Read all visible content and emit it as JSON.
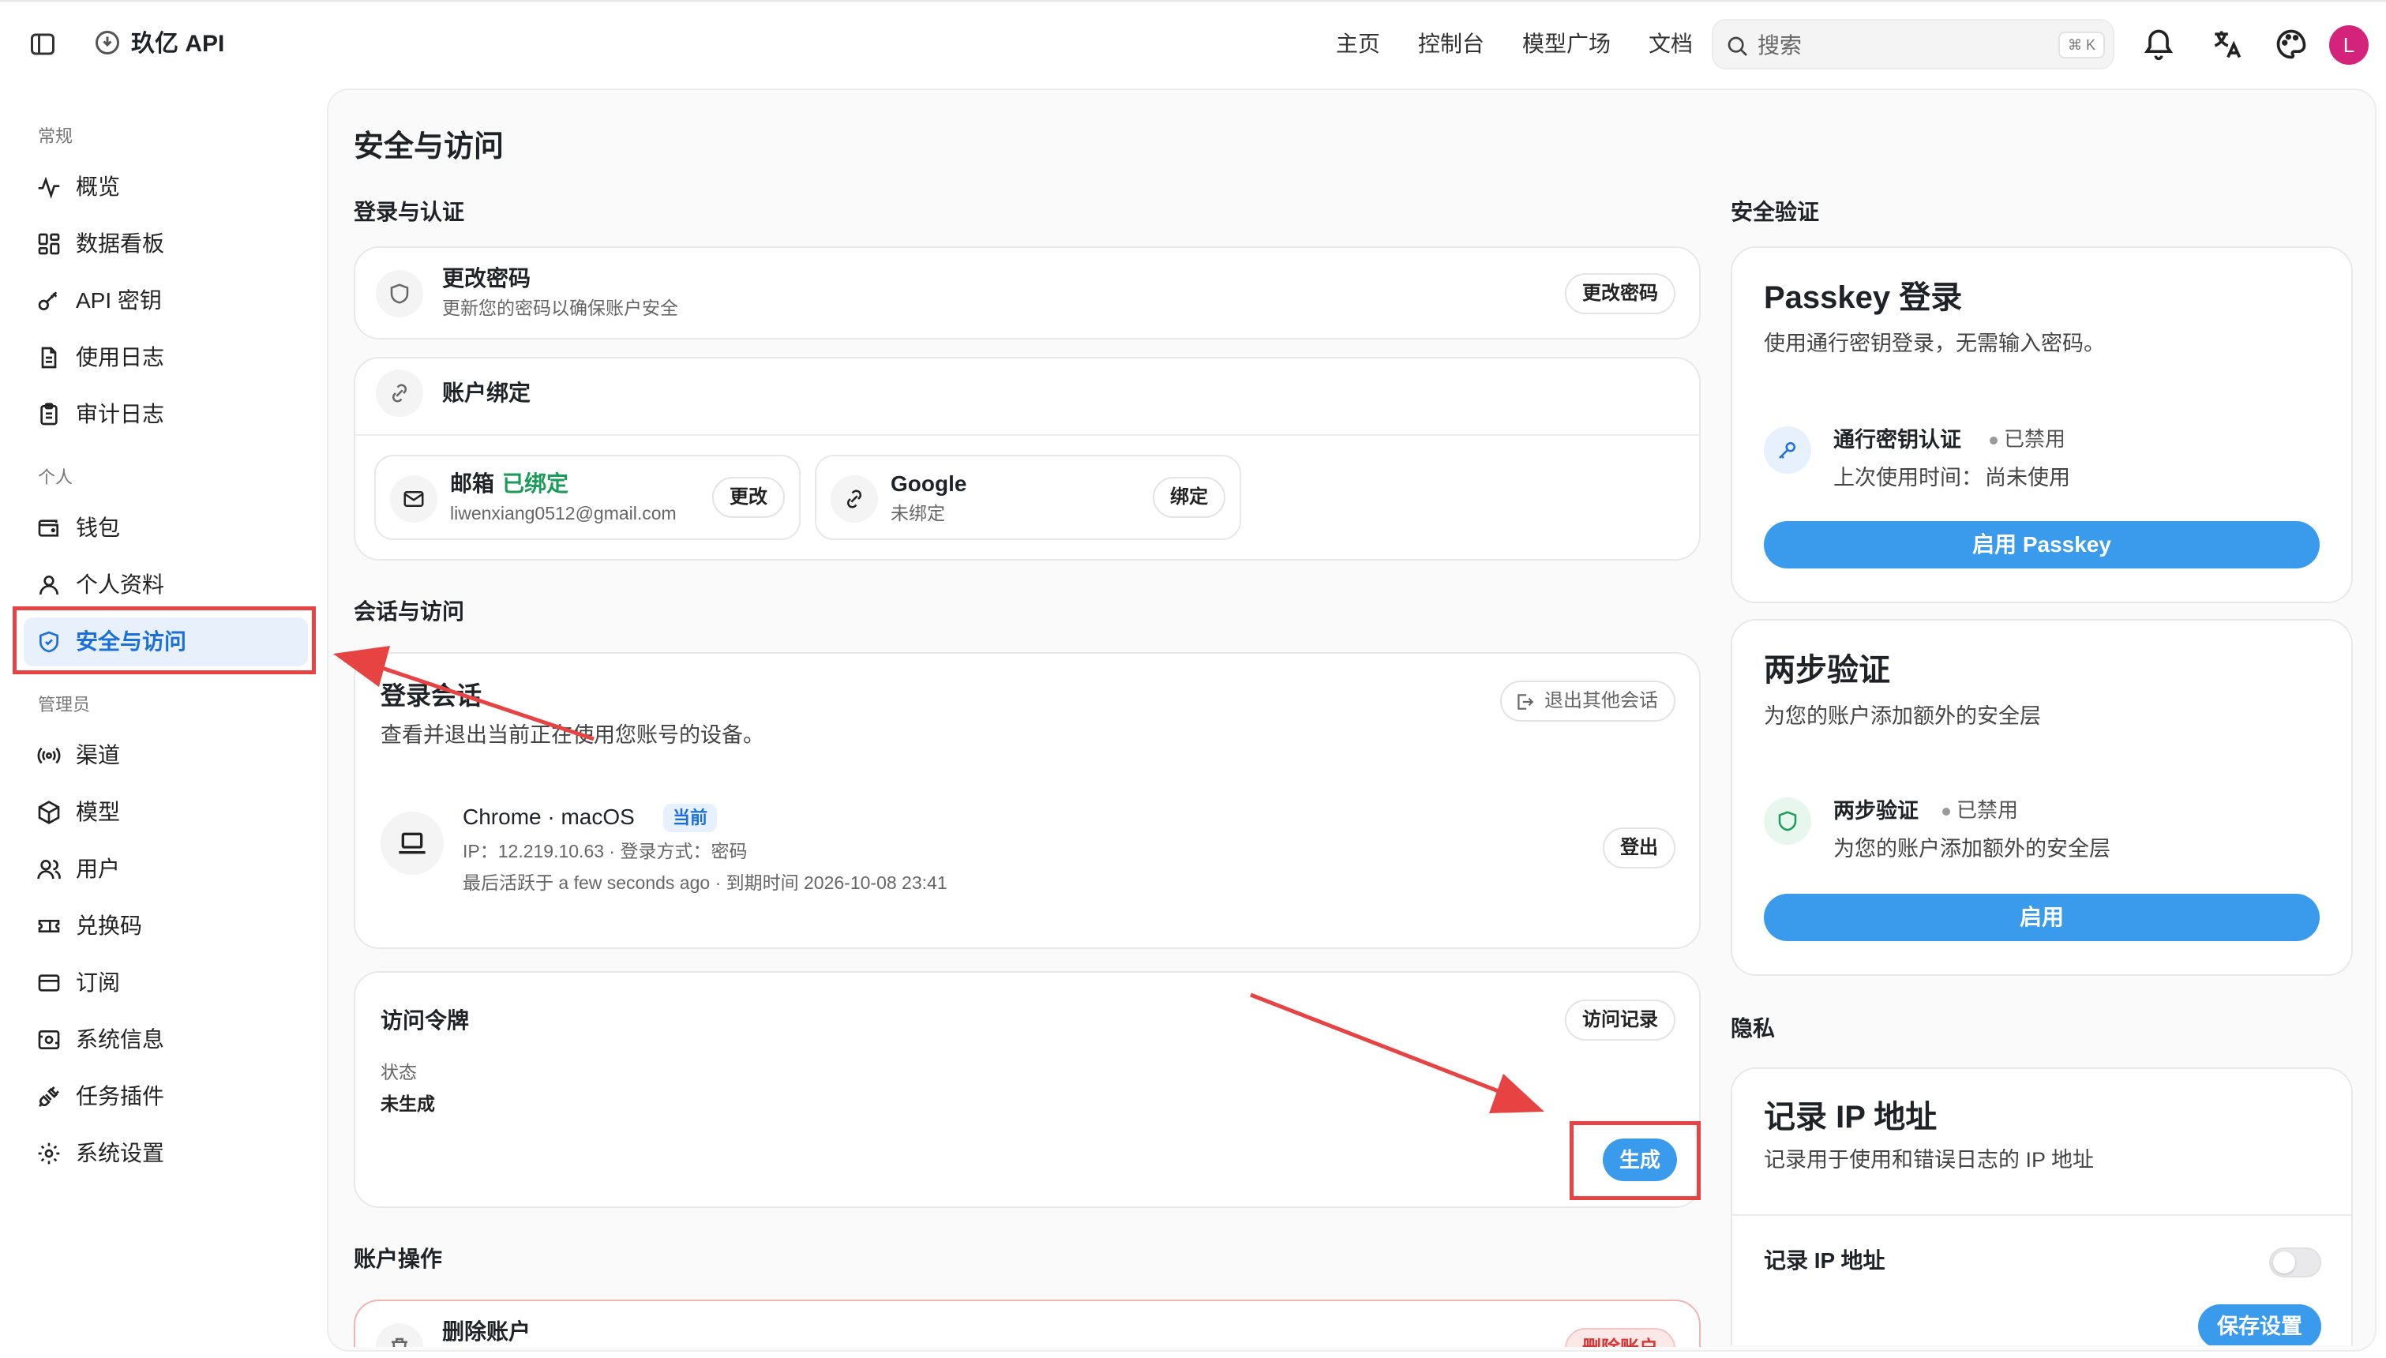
{
  "header": {
    "app_title": "玖亿 API",
    "nav": [
      "主页",
      "控制台",
      "模型广场",
      "文档"
    ],
    "search_placeholder": "搜索",
    "search_shortcut": "⌘ K",
    "avatar_letter": "L"
  },
  "sidebar": {
    "sections": [
      {
        "title": "常规",
        "items": [
          {
            "label": "概览",
            "icon": "activity-icon"
          },
          {
            "label": "数据看板",
            "icon": "dashboard-icon"
          },
          {
            "label": "API 密钥",
            "icon": "key-icon"
          },
          {
            "label": "使用日志",
            "icon": "file-text-icon"
          },
          {
            "label": "审计日志",
            "icon": "clipboard-icon"
          }
        ]
      },
      {
        "title": "个人",
        "items": [
          {
            "label": "钱包",
            "icon": "wallet-icon"
          },
          {
            "label": "个人资料",
            "icon": "user-icon"
          },
          {
            "label": "安全与访问",
            "icon": "shield-icon",
            "active": true
          }
        ]
      },
      {
        "title": "管理员",
        "items": [
          {
            "label": "渠道",
            "icon": "radio-icon"
          },
          {
            "label": "模型",
            "icon": "box-icon"
          },
          {
            "label": "用户",
            "icon": "users-icon"
          },
          {
            "label": "兑换码",
            "icon": "ticket-icon"
          },
          {
            "label": "订阅",
            "icon": "credit-card-icon"
          },
          {
            "label": "系统信息",
            "icon": "server-icon"
          },
          {
            "label": "任务插件",
            "icon": "plug-icon"
          },
          {
            "label": "系统设置",
            "icon": "settings-icon"
          }
        ]
      }
    ]
  },
  "page": {
    "title": "安全与访问",
    "login_auth": {
      "section_title": "登录与认证",
      "change_password": {
        "title": "更改密码",
        "desc": "更新您的密码以确保账户安全",
        "button": "更改密码"
      },
      "account_binding": {
        "title": "账户绑定",
        "email": {
          "label": "邮箱",
          "status": "已绑定",
          "value": "liwenxiang0512@gmail.com",
          "button": "更改"
        },
        "google": {
          "label": "Google",
          "status": "未绑定",
          "button": "绑定"
        }
      }
    },
    "sessions": {
      "section_title": "会话与访问",
      "login_sessions": {
        "title": "登录会话",
        "desc": "查看并退出当前正在使用您账号的设备。",
        "logout_others": "退出其他会话",
        "device": {
          "name": "Chrome · macOS",
          "badge": "当前",
          "line1": "IP：12.219.10.63 · 登录方式：密码",
          "line2": "最后活跃于 a few seconds ago · 到期时间 2026-10-08 23:41",
          "button": "登出"
        }
      },
      "access_token": {
        "title": "访问令牌",
        "history_button": "访问记录",
        "status_label": "状态",
        "status_value": "未生成",
        "generate_button": "生成"
      }
    },
    "account_ops": {
      "section_title": "账户操作",
      "delete_title": "删除账户",
      "delete_button": "删除账户"
    },
    "security_verify": {
      "section_title": "安全验证",
      "passkey": {
        "title": "Passkey 登录",
        "desc": "使用通行密钥登录，无需输入密码。",
        "item_title": "通行密钥认证",
        "item_status": "已禁用",
        "last_used_label": "上次使用时间：",
        "last_used_value": "尚未使用",
        "button": "启用 Passkey"
      },
      "two_factor": {
        "title": "两步验证",
        "desc": "为您的账户添加额外的安全层",
        "item_title": "两步验证",
        "item_status": "已禁用",
        "item_desc": "为您的账户添加额外的安全层",
        "button": "启用"
      }
    },
    "privacy": {
      "section_title": "隐私",
      "record_ip": {
        "title": "记录 IP 地址",
        "desc": "记录用于使用和错误日志的 IP 地址",
        "toggle_label": "记录 IP 地址",
        "toggle_on": false,
        "save_button": "保存设置"
      }
    }
  },
  "colors": {
    "accent": "#3a9bec",
    "annotation": "#e84343",
    "success": "#1a9b5a",
    "danger": "#e84343"
  }
}
